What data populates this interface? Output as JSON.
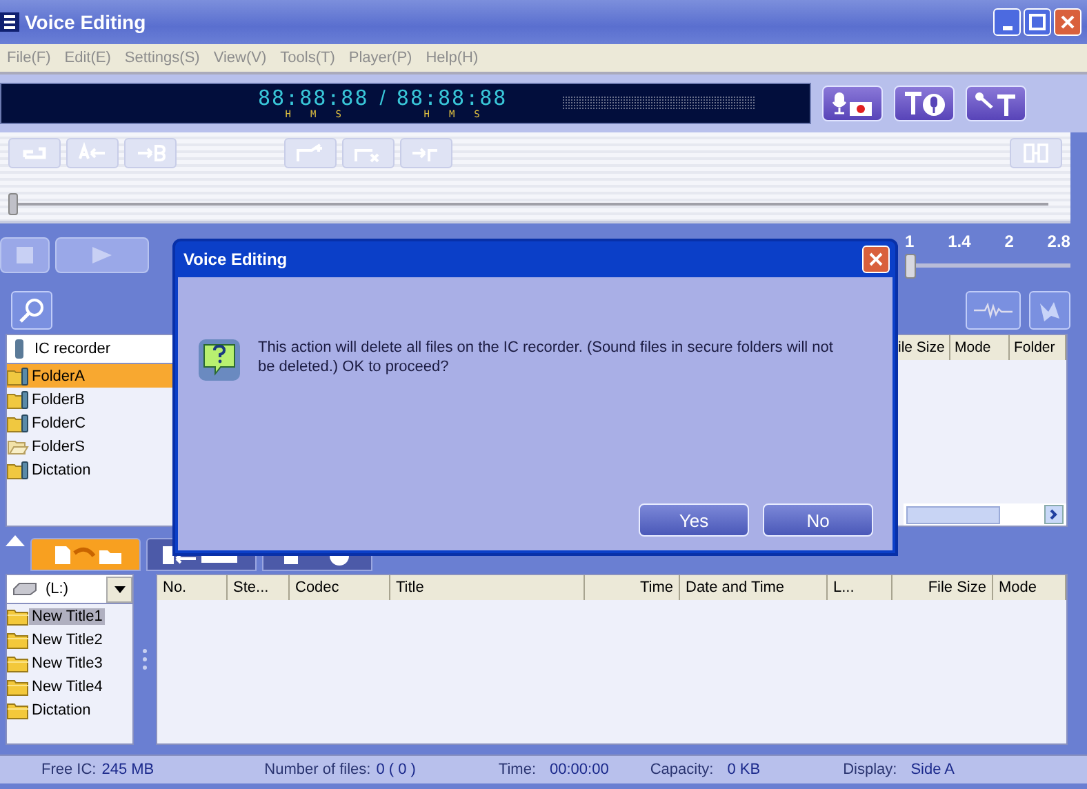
{
  "window": {
    "title": "Voice Editing"
  },
  "menu": [
    {
      "label": "File(F)"
    },
    {
      "label": "Edit(E)"
    },
    {
      "label": "Settings(S)"
    },
    {
      "label": "View(V)"
    },
    {
      "label": "Tools(T)"
    },
    {
      "label": "Player(P)"
    },
    {
      "label": "Help(H)"
    }
  ],
  "display": {
    "time": "88:88:88",
    "time_units": [
      "H",
      "M",
      "S"
    ],
    "separator": "/",
    "total": "88:88:88",
    "total_units": [
      "H",
      "M",
      "S"
    ]
  },
  "position_slider": {
    "level": 0.0
  },
  "speed": {
    "ticks": [
      "1",
      "1.4",
      "2",
      "2.8"
    ],
    "level": 0.0
  },
  "upper_tree": {
    "header": "IC recorder",
    "items": [
      {
        "label": "FolderA",
        "kind": "device",
        "selected": true
      },
      {
        "label": "FolderB",
        "kind": "device",
        "selected": false
      },
      {
        "label": "FolderC",
        "kind": "device",
        "selected": false
      },
      {
        "label": "FolderS",
        "kind": "secure",
        "selected": false
      },
      {
        "label": "Dictation",
        "kind": "device",
        "selected": false
      }
    ]
  },
  "upper_table": {
    "columns": [
      "ile Size",
      "Mode",
      "Folder"
    ]
  },
  "lower_tree": {
    "drive": "(L:)",
    "items": [
      {
        "label": "New Title1",
        "selected": true
      },
      {
        "label": "New Title2",
        "selected": false
      },
      {
        "label": "New Title3",
        "selected": false
      },
      {
        "label": "New Title4",
        "selected": false
      },
      {
        "label": "Dictation",
        "selected": false
      }
    ]
  },
  "lower_table": {
    "columns": [
      "No.",
      "Ste...",
      "Codec",
      "Title",
      "Time",
      "Date and Time",
      "L...",
      "File Size",
      "Mode"
    ]
  },
  "status_bar": [
    {
      "label": "Free IC:",
      "value": "245 MB"
    },
    {
      "label": "Number of files:",
      "value": "0 ( 0 )"
    },
    {
      "label": "Time:",
      "value": "00:00:00"
    },
    {
      "label": "Capacity:",
      "value": "0 KB"
    },
    {
      "label": "Display:",
      "value": "Side A"
    }
  ],
  "dialog": {
    "title": "Voice Editing",
    "message": "This action will delete all files on the IC recorder. (Sound files in secure folders will not be deleted.)  OK to proceed?",
    "buttons": [
      "Yes",
      "No"
    ]
  }
}
